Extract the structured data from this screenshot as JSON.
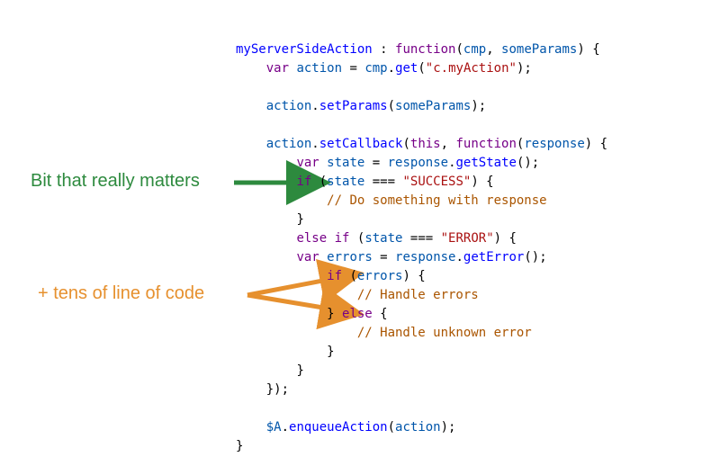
{
  "annot": {
    "green": "Bit that really matters",
    "orange": "+ tens of line of code"
  },
  "code": {
    "l1": {
      "fn": "myServerSideAction",
      "colon": " : ",
      "kw": "function",
      "args_open": "(",
      "a1": "cmp",
      "sep": ", ",
      "a2": "someParams",
      "args_close": ") {"
    },
    "l2": {
      "indent": "    ",
      "kw": "var",
      "sp": " ",
      "id": "action",
      "eq": " = ",
      "obj": "cmp",
      "dot": ".",
      "call": "get",
      "open": "(",
      "str": "\"c.myAction\"",
      "close": ");"
    },
    "l3": "",
    "l4": {
      "indent": "    ",
      "obj": "action",
      "dot": ".",
      "call": "setParams",
      "open": "(",
      "arg": "someParams",
      "close": ");"
    },
    "l5": "",
    "l6": {
      "indent": "    ",
      "obj": "action",
      "dot": ".",
      "call": "setCallback",
      "open": "(",
      "kw1": "this",
      "sep": ", ",
      "kw2": "function",
      "open2": "(",
      "arg": "response",
      "close2": ") {"
    },
    "l7": {
      "indent": "        ",
      "kw": "var",
      "sp": " ",
      "id": "state",
      "eq": " = ",
      "obj": "response",
      "dot": ".",
      "call": "getState",
      "paren": "();"
    },
    "l8": {
      "indent": "        ",
      "kw": "if",
      "sp": " (",
      "id": "state",
      "op": " === ",
      "str": "\"SUCCESS\"",
      "close": ") {"
    },
    "l9": {
      "indent": "            ",
      "comm": "// Do something with response"
    },
    "l10": {
      "indent": "        ",
      "brace": "}"
    },
    "l11": {
      "indent": "        ",
      "kw1": "else",
      "sp1": " ",
      "kw2": "if",
      "sp2": " (",
      "id": "state",
      "op": " === ",
      "str": "\"ERROR\"",
      "close": ") {"
    },
    "l12": {
      "indent": "        ",
      "kw": "var",
      "sp": " ",
      "id": "errors",
      "eq": " = ",
      "obj": "response",
      "dot": ".",
      "call": "getError",
      "paren": "();"
    },
    "l13": {
      "indent": "            ",
      "kw": "if",
      "sp": " (",
      "id": "errors",
      "close": ") {"
    },
    "l14": {
      "indent": "                ",
      "comm": "// Handle errors"
    },
    "l15": {
      "indent": "            ",
      "close": "} ",
      "kw": "else",
      "open": " {"
    },
    "l16": {
      "indent": "                ",
      "comm": "// Handle unknown error"
    },
    "l17": {
      "indent": "            ",
      "brace": "}"
    },
    "l18": {
      "indent": "        ",
      "brace": "}"
    },
    "l19": {
      "indent": "    ",
      "brace": "});"
    },
    "l20": "",
    "l21": {
      "indent": "    ",
      "obj": "$A",
      "dot": ".",
      "call": "enqueueAction",
      "open": "(",
      "arg": "action",
      "close": ");"
    },
    "l22": {
      "brace": "}"
    }
  }
}
